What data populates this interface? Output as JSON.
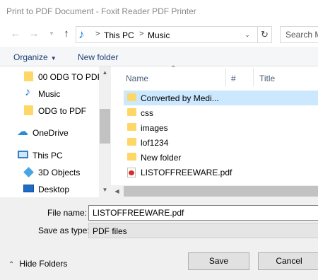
{
  "window": {
    "title": "Print to PDF Document - Foxit Reader PDF Printer"
  },
  "nav": {
    "back_icon": "arrow-left-icon",
    "forward_icon": "arrow-right-icon",
    "recent_icon": "chevron-down-icon",
    "up_icon": "arrow-up-icon",
    "breadcrumb": [
      "This PC",
      "Music"
    ],
    "separator": ">",
    "search_placeholder": "Search M"
  },
  "toolbar": {
    "organize_label": "Organize",
    "new_folder_label": "New folder"
  },
  "sidebar": {
    "items": [
      {
        "label": "00 ODG TO PDF",
        "icon": "folder-icon"
      },
      {
        "label": "Music",
        "icon": "music-icon"
      },
      {
        "label": "ODG to PDF",
        "icon": "folder-icon"
      },
      {
        "label": "OneDrive",
        "icon": "cloud-icon"
      },
      {
        "label": "This PC",
        "icon": "computer-icon"
      },
      {
        "label": "3D Objects",
        "icon": "cube-icon"
      },
      {
        "label": "Desktop",
        "icon": "desktop-icon"
      }
    ]
  },
  "columns": [
    "Name",
    "#",
    "Title"
  ],
  "files": [
    {
      "name": "Converted by Medi...",
      "type": "folder",
      "selected": true
    },
    {
      "name": "css",
      "type": "folder"
    },
    {
      "name": "images",
      "type": "folder"
    },
    {
      "name": "lof1234",
      "type": "folder"
    },
    {
      "name": "New folder",
      "type": "folder"
    },
    {
      "name": "LISTOFFREEWARE.pdf",
      "type": "pdf"
    }
  ],
  "form": {
    "file_name_label": "File name:",
    "file_name_value": "LISTOFFREEWARE.pdf",
    "save_type_label": "Save as type:",
    "save_type_value": "PDF files"
  },
  "footer": {
    "hide_folders_label": "Hide Folders",
    "save_label": "Save",
    "cancel_label": "Cancel"
  },
  "colors": {
    "accent": "#1e7fd6",
    "selection": "#cce8ff",
    "folder": "#ffd767",
    "link": "#1a3e75"
  }
}
